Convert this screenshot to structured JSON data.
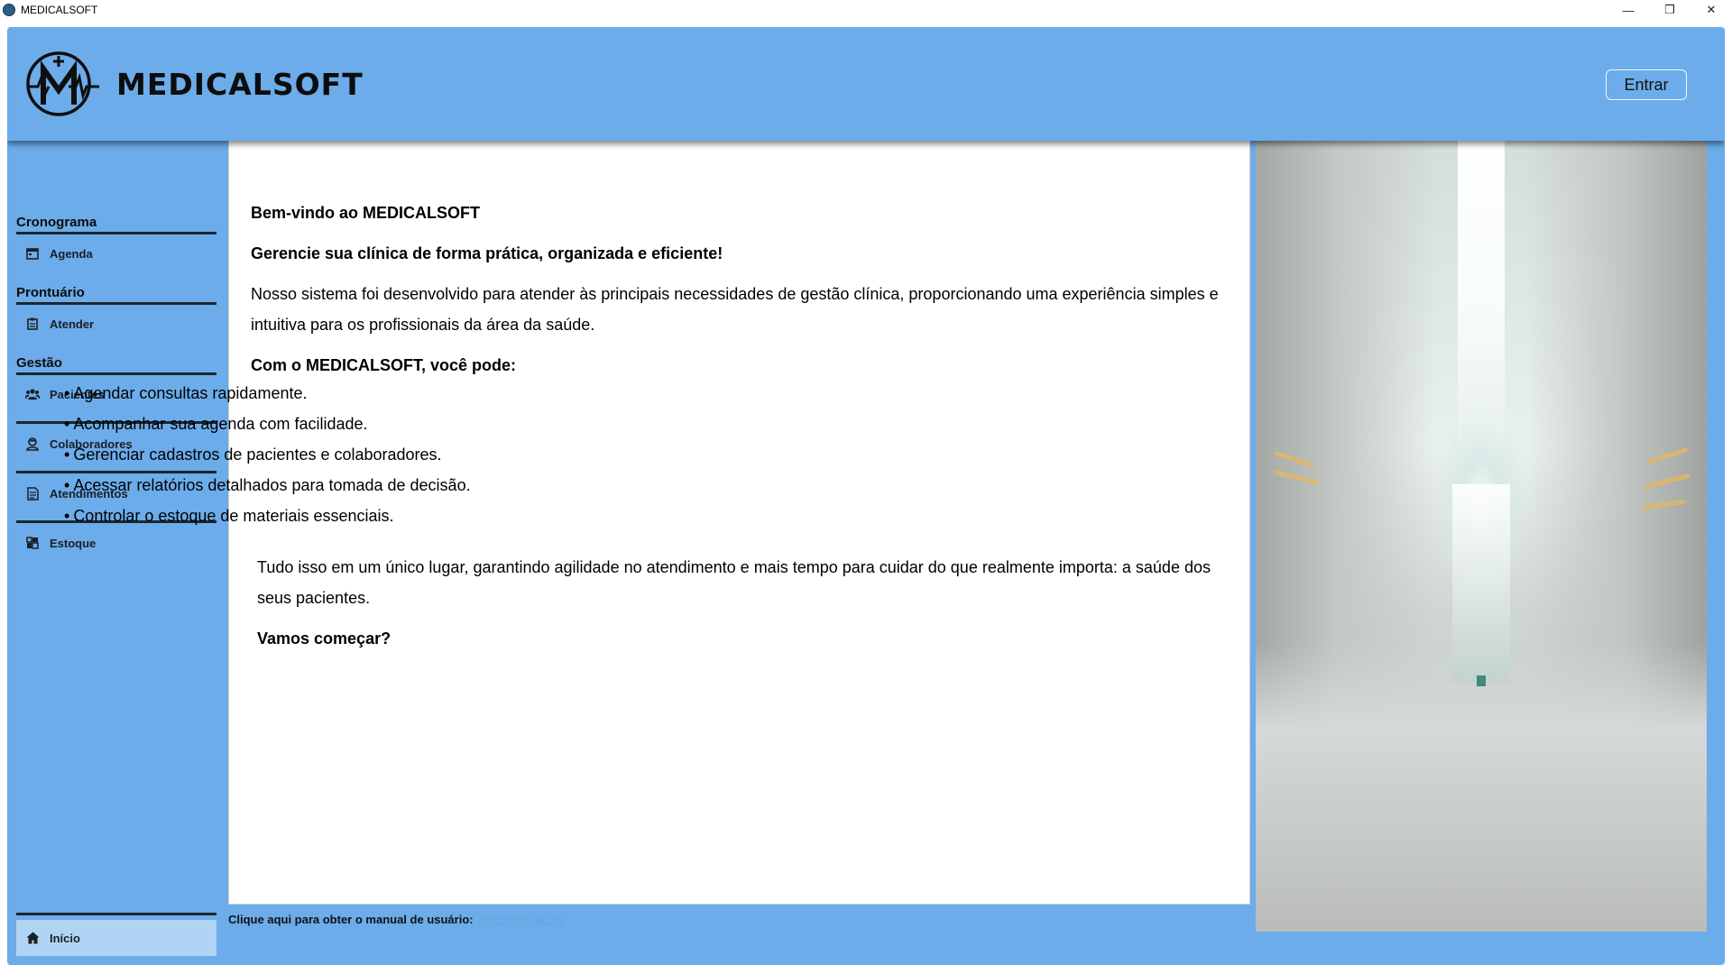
{
  "window": {
    "title": "MEDICALSOFT",
    "controls": {
      "minimize": "—",
      "restore": "❐",
      "close": "✕"
    }
  },
  "header": {
    "brand": "MEDICALSOFT",
    "login_label": "Entrar",
    "bg_color": "#6cacea"
  },
  "sidebar": {
    "sections": [
      {
        "title": "Cronograma",
        "items": [
          {
            "label": "Agenda",
            "icon": "calendar-icon"
          }
        ]
      },
      {
        "title": "Prontuário",
        "items": [
          {
            "label": "Atender",
            "icon": "clipboard-icon"
          }
        ]
      },
      {
        "title": "Gestão",
        "items": [
          {
            "label": "Pacientes",
            "icon": "users-icon"
          },
          {
            "label": "Colaboradores",
            "icon": "staff-icon"
          },
          {
            "label": "Atendimentos",
            "icon": "document-icon"
          },
          {
            "label": "Estoque",
            "icon": "warehouse-icon"
          }
        ]
      }
    ],
    "home": {
      "label": "Início",
      "icon": "home-icon",
      "active": true
    }
  },
  "content": {
    "welcome": "Bem-vindo ao MEDICALSOFT",
    "tagline": "Gerencie sua clínica de forma prática, organizada e eficiente!",
    "intro": "Nosso sistema foi desenvolvido para atender às principais necessidades de gestão clínica, proporcionando uma experiência simples e intuitiva para os profissionais da área da saúde.",
    "features_heading": "Com o MEDICALSOFT, você pode:",
    "features": [
      "Agendar consultas rapidamente.",
      "Acompanhar sua agenda com facilidade.",
      "Gerenciar cadastros de pacientes e colaboradores.",
      "Acessar relatórios detalhados para tomada de decisão.",
      "Controlar o estoque de materiais essenciais."
    ],
    "closing": "Tudo isso em um único lugar, garantindo agilidade no atendimento e mais tempo para cuidar do que realmente importa: a saúde dos seus pacientes.",
    "cta": "Vamos começar?"
  },
  "footer": {
    "label": "Clique aqui para obter o manual de usuário:",
    "link": "Instruções de uso",
    "link_color": "#63a7dd"
  }
}
